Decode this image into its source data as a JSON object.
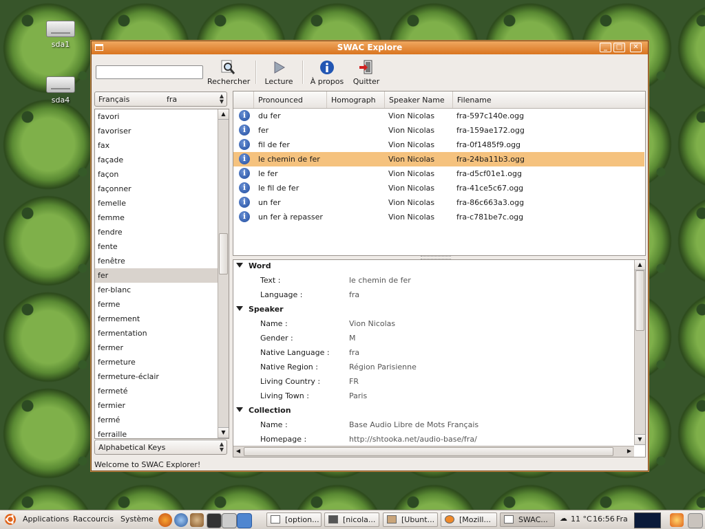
{
  "desktop": {
    "icons": [
      {
        "label": "sda1"
      },
      {
        "label": "sda4"
      }
    ]
  },
  "window": {
    "title": "SWAC Explore",
    "toolbar": {
      "search_value": "",
      "buttons": [
        {
          "label": "Rechercher",
          "icon": "search-icon"
        },
        {
          "label": "Lecture",
          "icon": "play-icon"
        },
        {
          "label": "À propos",
          "icon": "info-icon"
        },
        {
          "label": "Quitter",
          "icon": "exit-icon"
        }
      ]
    },
    "language_combo": {
      "name": "Français",
      "code": "fra"
    },
    "word_list": [
      "favori",
      "favoriser",
      "fax",
      "façade",
      "façon",
      "façonner",
      "femelle",
      "femme",
      "fendre",
      "fente",
      "fenêtre",
      "fer",
      "fer-blanc",
      "ferme",
      "fermement",
      "fermentation",
      "fermer",
      "fermeture",
      "fermeture-éclair",
      "fermeté",
      "fermier",
      "fermé",
      "ferraille"
    ],
    "word_list_selected": "fer",
    "sort_combo": "Alphabetical Keys",
    "table": {
      "columns": [
        "Pronounced",
        "Homograph",
        "Speaker Name",
        "Filename"
      ],
      "rows": [
        {
          "pronounced": "du fer",
          "homograph": "",
          "speaker": "Vion Nicolas",
          "filename": "fra-597c140e.ogg"
        },
        {
          "pronounced": "fer",
          "homograph": "",
          "speaker": "Vion Nicolas",
          "filename": "fra-159ae172.ogg"
        },
        {
          "pronounced": "fil de fer",
          "homograph": "",
          "speaker": "Vion Nicolas",
          "filename": "fra-0f1485f9.ogg"
        },
        {
          "pronounced": "le chemin de fer",
          "homograph": "",
          "speaker": "Vion Nicolas",
          "filename": "fra-24ba11b3.ogg"
        },
        {
          "pronounced": "le fer",
          "homograph": "",
          "speaker": "Vion Nicolas",
          "filename": "fra-d5cf01e1.ogg"
        },
        {
          "pronounced": "le fil de fer",
          "homograph": "",
          "speaker": "Vion Nicolas",
          "filename": "fra-41ce5c67.ogg"
        },
        {
          "pronounced": "un fer",
          "homograph": "",
          "speaker": "Vion Nicolas",
          "filename": "fra-86c663a3.ogg"
        },
        {
          "pronounced": "un fer à repasser",
          "homograph": "",
          "speaker": "Vion Nicolas",
          "filename": "fra-c781be7c.ogg"
        }
      ],
      "selected_row": "le chemin de fer"
    },
    "details": {
      "sections": [
        {
          "title": "Word",
          "fields": [
            {
              "label": "Text :",
              "value": "le chemin de fer"
            },
            {
              "label": "Language :",
              "value": "fra"
            }
          ]
        },
        {
          "title": "Speaker",
          "fields": [
            {
              "label": "Name :",
              "value": "Vion Nicolas"
            },
            {
              "label": "Gender :",
              "value": "M"
            },
            {
              "label": "Native Language :",
              "value": "fra"
            },
            {
              "label": "Native Region :",
              "value": "Région Parisienne"
            },
            {
              "label": "Living Country :",
              "value": "FR"
            },
            {
              "label": "Living Town :",
              "value": "Paris"
            }
          ]
        },
        {
          "title": "Collection",
          "fields": [
            {
              "label": "Name :",
              "value": "Base Audio Libre de Mots Français"
            },
            {
              "label": "Homepage :",
              "value": "http://shtooka.net/audio-base/fra/"
            }
          ]
        }
      ]
    },
    "status": "Welcome to SWAC Explorer!"
  },
  "panel": {
    "menus": [
      "Applications",
      "Raccourcis",
      "Système"
    ],
    "tasks": [
      {
        "label": "[option..."
      },
      {
        "label": "[nicola..."
      },
      {
        "label": "[Ubunt..."
      },
      {
        "label": "[Mozill..."
      },
      {
        "label": "SWAC..."
      }
    ],
    "weather": "11 °C",
    "clock": "16:56",
    "keyboard_layout": "Fra"
  },
  "colors": {
    "titlebar": "#d9741f",
    "selection": "#f5c27e",
    "panel": "#e6e1dc"
  }
}
